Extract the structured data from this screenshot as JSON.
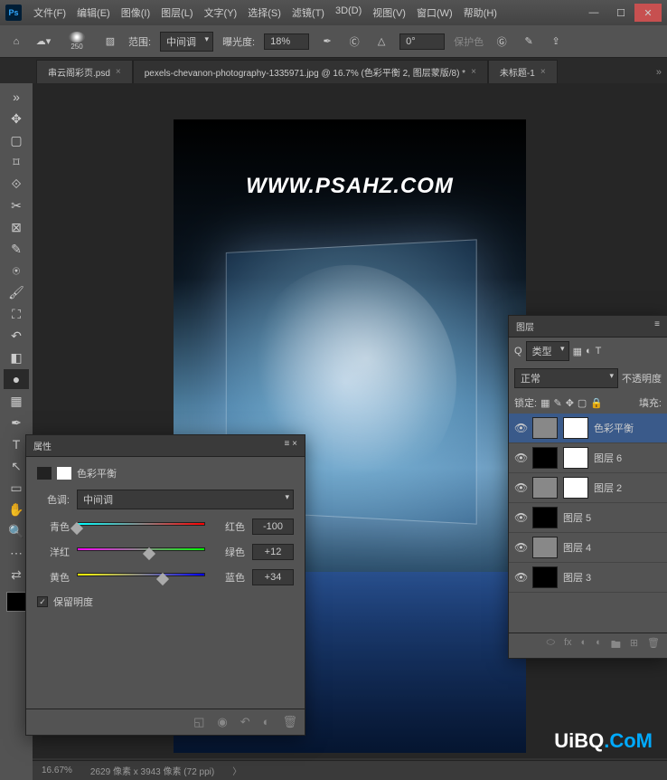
{
  "app": {
    "icon_text": "Ps"
  },
  "menu": [
    "文件(F)",
    "编辑(E)",
    "图像(I)",
    "图层(L)",
    "文字(Y)",
    "选择(S)",
    "滤镜(T)",
    "3D(D)",
    "视图(V)",
    "窗口(W)",
    "帮助(H)"
  ],
  "options": {
    "brush_size": "250",
    "range_label": "范围:",
    "range_value": "中间调",
    "exposure_label": "曝光度:",
    "exposure_value": "18%",
    "angle_value": "0°",
    "protect": "保护色"
  },
  "tabs": [
    {
      "label": "串云阁彩页.psd",
      "active": false
    },
    {
      "label": "pexels-chevanon-photography-1335971.jpg @ 16.7% (色彩平衡 2, 图层蒙版/8) *",
      "active": true
    },
    {
      "label": "未标题-1",
      "active": false
    }
  ],
  "canvas": {
    "watermark": "WWW.PSAHZ.COM"
  },
  "brand": {
    "a": "UiBQ",
    "b": ".CoM"
  },
  "properties": {
    "panel_title": "属性",
    "adj_name": "色彩平衡",
    "tone_label": "色调:",
    "tone_value": "中间调",
    "sliders": [
      {
        "left": "青色",
        "right": "红色",
        "value": "-100",
        "grad": "cr",
        "pos": 0
      },
      {
        "left": "洋红",
        "right": "绿色",
        "value": "+12",
        "grad": "mg",
        "pos": 56
      },
      {
        "left": "黄色",
        "right": "蓝色",
        "value": "+34",
        "grad": "yb",
        "pos": 67
      }
    ],
    "preserve": "保留明度",
    "preserve_checked": "✓"
  },
  "layers": {
    "panel_title": "图层",
    "filter_label": "类型",
    "blend_mode": "正常",
    "opacity_label": "不透明度",
    "lock_label": "锁定:",
    "fill_label": "填充:",
    "items": [
      {
        "name": "色彩平衡",
        "selected": true,
        "mask": true
      },
      {
        "name": "图层 6",
        "mask": true
      },
      {
        "name": "图层 2",
        "mask": true
      },
      {
        "name": "图层 5"
      },
      {
        "name": "图层 4"
      },
      {
        "name": "图层 3"
      }
    ]
  },
  "status": {
    "zoom": "16.67%",
    "dims": "2629 像素 x 3943 像素 (72 ppi)"
  },
  "icons": {
    "search": "Q",
    "link": "⬭",
    "fx": "fx",
    "mask": "◐",
    "folder": "🖿",
    "new": "⊞",
    "trash": "🗑",
    "eye": "👁",
    "chev": "»",
    "angle": "△"
  }
}
